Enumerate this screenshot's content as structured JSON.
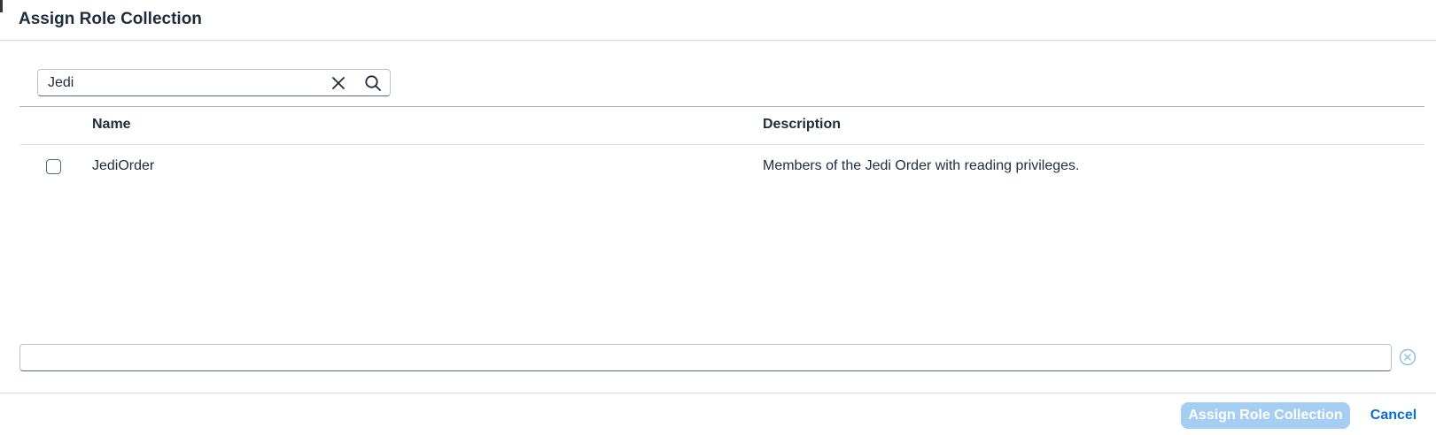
{
  "dialog": {
    "title": "Assign Role Collection"
  },
  "search": {
    "value": "Jedi",
    "clear_icon": "close-icon",
    "search_icon": "search-icon"
  },
  "table": {
    "columns": [
      "Name",
      "Description"
    ],
    "rows": [
      {
        "selected": false,
        "name": "JediOrder",
        "description": "Members of the Jedi Order with reading privileges."
      }
    ]
  },
  "bottom_field": {
    "value": "",
    "clear_icon": "clear-circle-icon"
  },
  "footer": {
    "primary_label": "Assign Role Collection",
    "primary_enabled": false,
    "cancel_label": "Cancel"
  },
  "colors": {
    "primary_disabled": "#a6cdf2",
    "link": "#0a6ed1",
    "text": "#1d2d3e"
  }
}
